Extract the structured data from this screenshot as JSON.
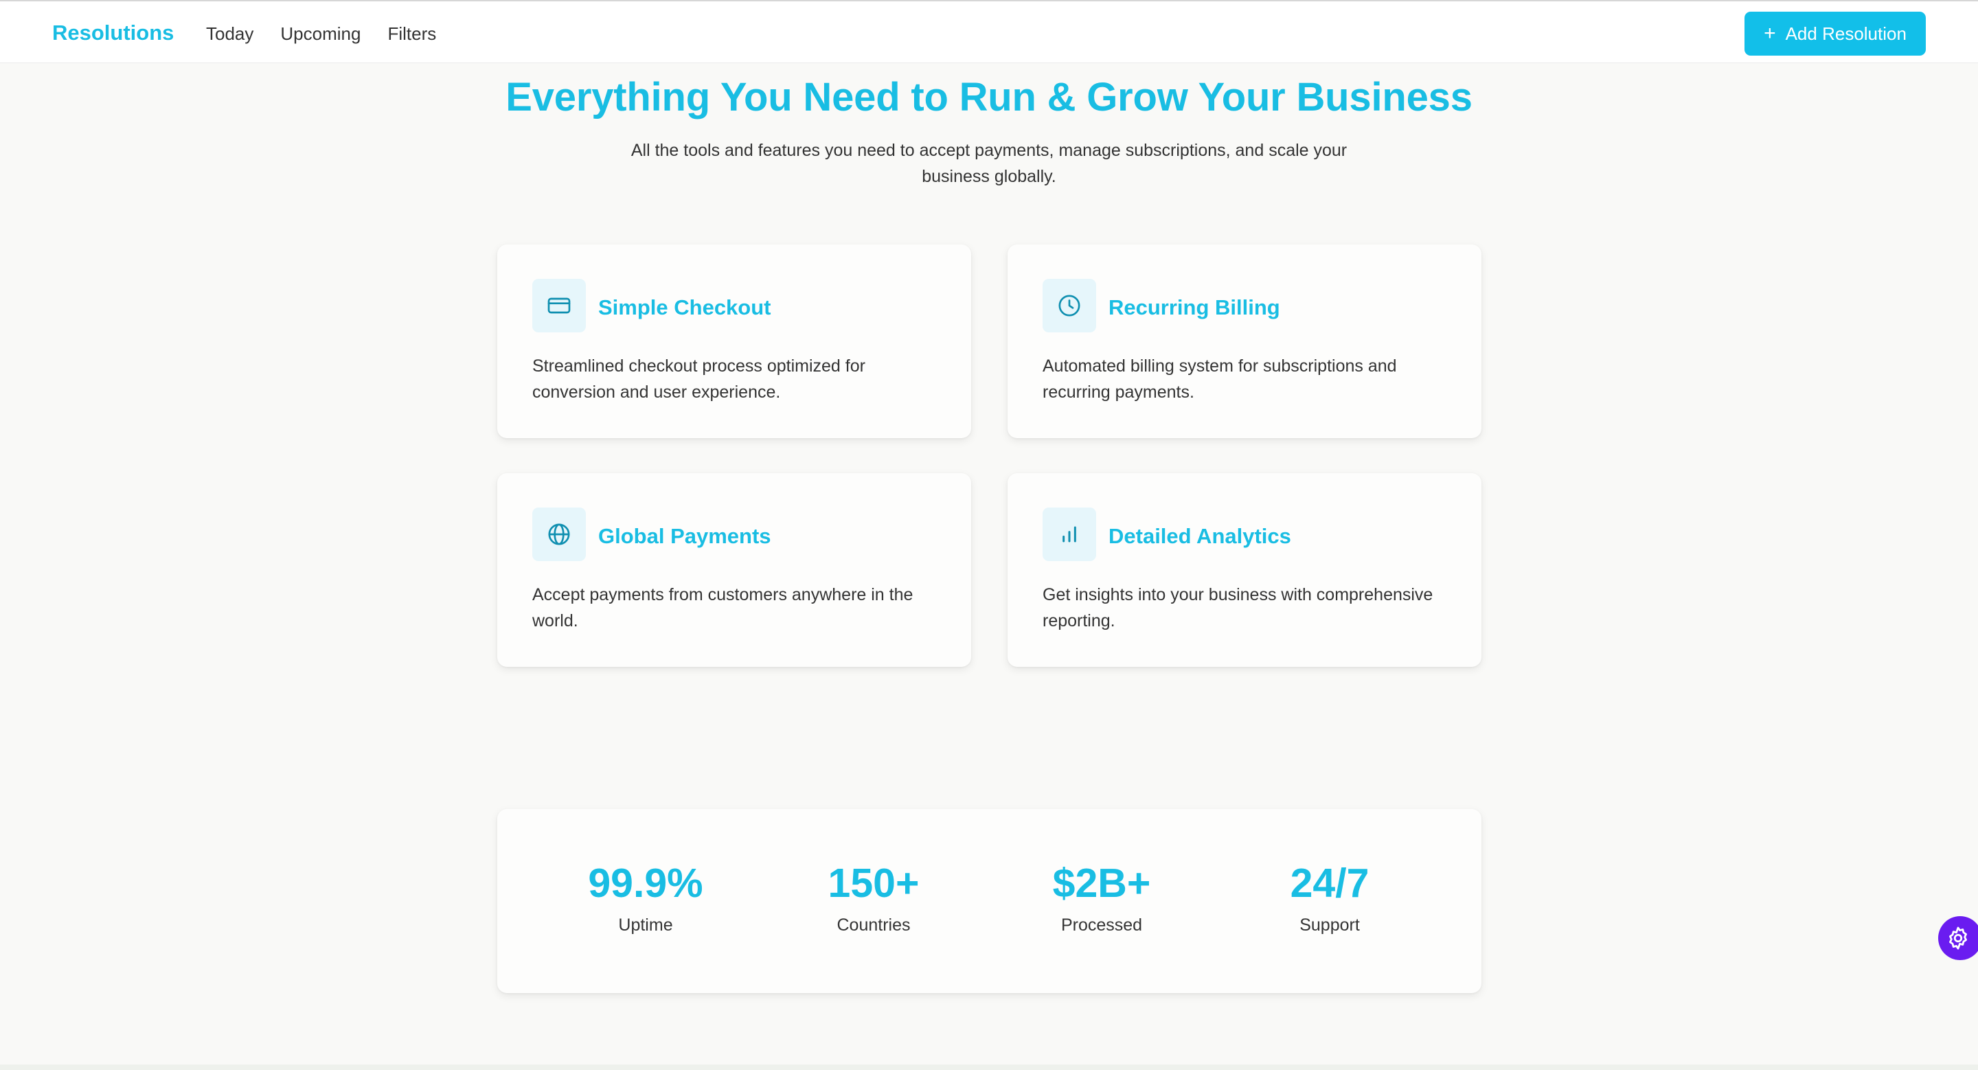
{
  "header": {
    "brand": "Resolutions",
    "nav": [
      "Today",
      "Upcoming",
      "Filters"
    ],
    "add_button": "Add Resolution"
  },
  "hero": {
    "title": "Everything You Need to Run & Grow Your Business",
    "subtitle": "All the tools and features you need to accept payments, manage subscriptions, and scale your business globally."
  },
  "features": [
    {
      "icon": "credit-card-icon",
      "title": "Simple Checkout",
      "description": "Streamlined checkout process optimized for conversion and user experience."
    },
    {
      "icon": "clock-icon",
      "title": "Recurring Billing",
      "description": "Automated billing system for subscriptions and recurring payments."
    },
    {
      "icon": "globe-icon",
      "title": "Global Payments",
      "description": "Accept payments from customers anywhere in the world."
    },
    {
      "icon": "bar-chart-icon",
      "title": "Detailed Analytics",
      "description": "Get insights into your business with comprehensive reporting."
    }
  ],
  "stats": [
    {
      "value": "99.9%",
      "label": "Uptime"
    },
    {
      "value": "150+",
      "label": "Countries"
    },
    {
      "value": "$2B+",
      "label": "Processed"
    },
    {
      "value": "24/7",
      "label": "Support"
    }
  ],
  "colors": {
    "accent": "#19bde3",
    "button": "#12bfe9",
    "icon_bg": "#e6f6fb",
    "fab": "#6a1cf0",
    "background": "#f9f9f7"
  },
  "floating_button": {
    "icon": "gear-icon"
  }
}
